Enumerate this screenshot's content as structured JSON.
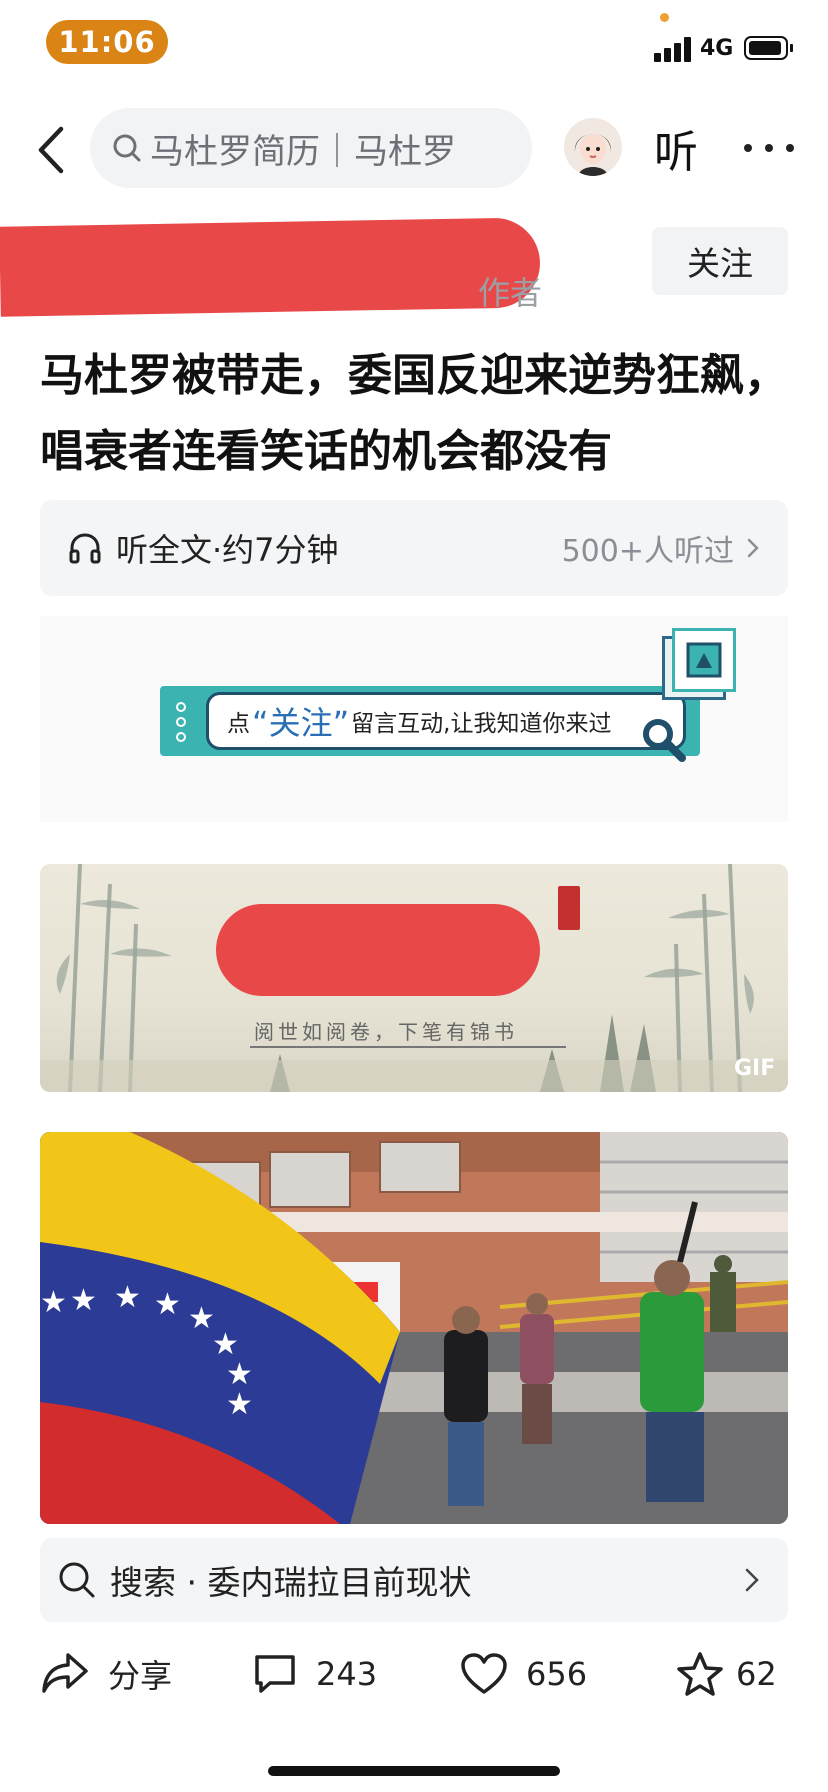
{
  "status_bar": {
    "time": "11:06",
    "network": "4G"
  },
  "nav": {
    "search_text": "马杜罗简历｜马杜罗",
    "listen_label": "听"
  },
  "author": {
    "role": "作者",
    "follow_label": "关注"
  },
  "article": {
    "title": "马杜罗被带走，委国反迎来逆势狂飙，唱衰者连看笑话的机会都没有"
  },
  "listen_bar": {
    "label": "听全文·约7分钟",
    "count": "500+人听过"
  },
  "banner": {
    "prefix": "点",
    "quoted": "“关注”",
    "suffix": "留言互动,让我知道你来过"
  },
  "ink_image": {
    "caption": "阅世如阅卷，下笔有锦书",
    "gif_tag": "GIF"
  },
  "search_suggestion": {
    "text": "搜索 · 委内瑞拉目前现状"
  },
  "actions": {
    "share": "分享",
    "comments": "243",
    "likes": "656",
    "favorites": "62"
  },
  "colors": {
    "time_pill": "#d98414",
    "redaction": "#e84848",
    "banner_teal": "#3bb3b0",
    "banner_blue": "#2a6fb5"
  },
  "icons": [
    "back-icon",
    "search-icon",
    "headphones-icon",
    "chevron-right-icon",
    "share-icon",
    "comment-icon",
    "heart-icon",
    "star-icon",
    "more-icon"
  ]
}
